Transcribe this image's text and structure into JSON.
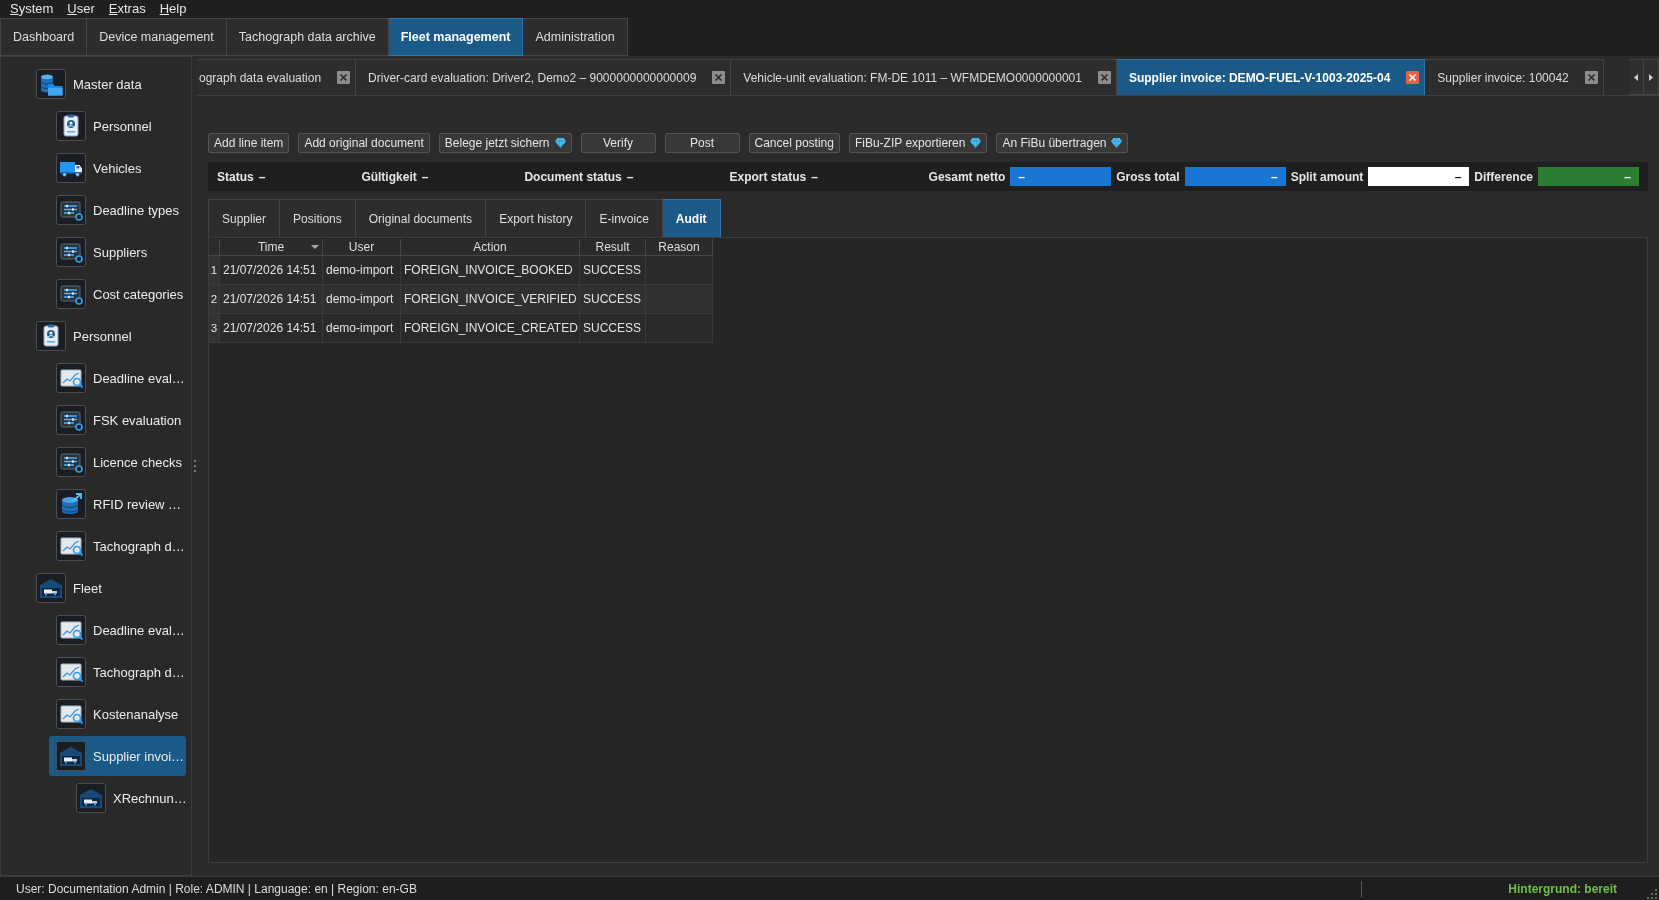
{
  "menu": [
    "System",
    "User",
    "Extras",
    "Help"
  ],
  "main_tabs": [
    {
      "label": "Dashboard",
      "selected": false
    },
    {
      "label": "Device management",
      "selected": false
    },
    {
      "label": "Tachograph data archive",
      "selected": false
    },
    {
      "label": "Fleet management",
      "selected": true
    },
    {
      "label": "Administration",
      "selected": false
    }
  ],
  "sidebar": {
    "items": [
      {
        "label": "Master data",
        "selected": false,
        "children": [
          {
            "label": "Personnel",
            "selected": false
          },
          {
            "label": "Vehicles",
            "selected": false
          },
          {
            "label": "Deadline types",
            "selected": false
          },
          {
            "label": "Suppliers",
            "selected": false
          },
          {
            "label": "Cost categories",
            "selected": false
          }
        ]
      },
      {
        "label": "Personnel",
        "selected": false,
        "children": [
          {
            "label": "Deadline eval…",
            "selected": false
          },
          {
            "label": "FSK evaluation",
            "selected": false
          },
          {
            "label": "Licence checks",
            "selected": false
          },
          {
            "label": "RFID review …",
            "selected": false
          },
          {
            "label": "Tachograph d…",
            "selected": false
          }
        ]
      },
      {
        "label": "Fleet",
        "selected": false,
        "children": [
          {
            "label": "Deadline eval…",
            "selected": false
          },
          {
            "label": "Tachograph d…",
            "selected": false
          },
          {
            "label": "Kostenanalyse",
            "selected": false
          },
          {
            "label": "Supplier invoi…",
            "selected": true,
            "children": [
              {
                "label": "XRechnun…",
                "selected": false
              }
            ]
          }
        ]
      }
    ]
  },
  "document_tabs": [
    {
      "label": "ograph data evaluation",
      "selected": false
    },
    {
      "label": "Driver-card evaluation: Driver2, Demo2 – 9000000000000009",
      "selected": false
    },
    {
      "label": "Vehicle-unit evaluation: FM-DE 1011 – WFMDEMO0000000001",
      "selected": false
    },
    {
      "label": "Supplier invoice: DEMO-FUEL-V-1003-2025-04",
      "selected": true
    },
    {
      "label": "Supplier invoice: 100042",
      "selected": false
    }
  ],
  "toolbar": [
    {
      "label": "Add line item",
      "kind": "plain"
    },
    {
      "label": "Add original document",
      "kind": "plain"
    },
    {
      "label": "Belege jetzt sichern",
      "kind": "premium"
    },
    {
      "label": "Verify",
      "kind": "plain"
    },
    {
      "label": "Post",
      "kind": "plain"
    },
    {
      "label": "Cancel posting",
      "kind": "plain"
    },
    {
      "label": "FiBu-ZIP exportieren",
      "kind": "premium"
    },
    {
      "label": "An FiBu übertragen",
      "kind": "premium"
    }
  ],
  "summary": {
    "statuses": [
      {
        "label": "Status",
        "value": "–"
      },
      {
        "label": "Gültigkeit",
        "value": "–"
      },
      {
        "label": "Document status",
        "value": "–"
      },
      {
        "label": "Export status",
        "value": "–"
      }
    ],
    "amounts": [
      {
        "label": "Gesamt netto",
        "value": "–",
        "color": "#1976d2"
      },
      {
        "label": "Gross total",
        "value": "–",
        "color": "#1976d2"
      },
      {
        "label": "Split amount",
        "value": "–",
        "color": "#ffffff"
      },
      {
        "label": "Difference",
        "value": "–",
        "color": "#2e7d32"
      }
    ]
  },
  "detail_tabs": [
    {
      "label": "Supplier",
      "selected": false
    },
    {
      "label": "Positions",
      "selected": false
    },
    {
      "label": "Original documents",
      "selected": false
    },
    {
      "label": "Export history",
      "selected": false
    },
    {
      "label": "E-invoice",
      "selected": false
    },
    {
      "label": "Audit",
      "selected": true
    }
  ],
  "audit_table": {
    "columns": [
      {
        "label": "Time",
        "sorted": true
      },
      {
        "label": "User",
        "sorted": false
      },
      {
        "label": "Action",
        "sorted": false
      },
      {
        "label": "Result",
        "sorted": false
      },
      {
        "label": "Reason",
        "sorted": false
      }
    ],
    "rows": [
      {
        "number": "1",
        "cells": [
          "21/07/2026 14:51",
          "demo-import",
          "FOREIGN_INVOICE_BOOKED",
          "SUCCESS"
        ]
      },
      {
        "number": "2",
        "cells": [
          "21/07/2026 14:51",
          "demo-import",
          "FOREIGN_INVOICE_VERIFIED",
          "SUCCESS"
        ]
      },
      {
        "number": "3",
        "cells": [
          "21/07/2026 14:51",
          "demo-import",
          "FOREIGN_INVOICE_CREATED",
          "SUCCESS"
        ]
      }
    ]
  },
  "status_bar": {
    "session": "User: Documentation Admin | Role: ADMIN | Language: en | Region: en-GB",
    "background_task": "Hintergrund: bereit"
  }
}
